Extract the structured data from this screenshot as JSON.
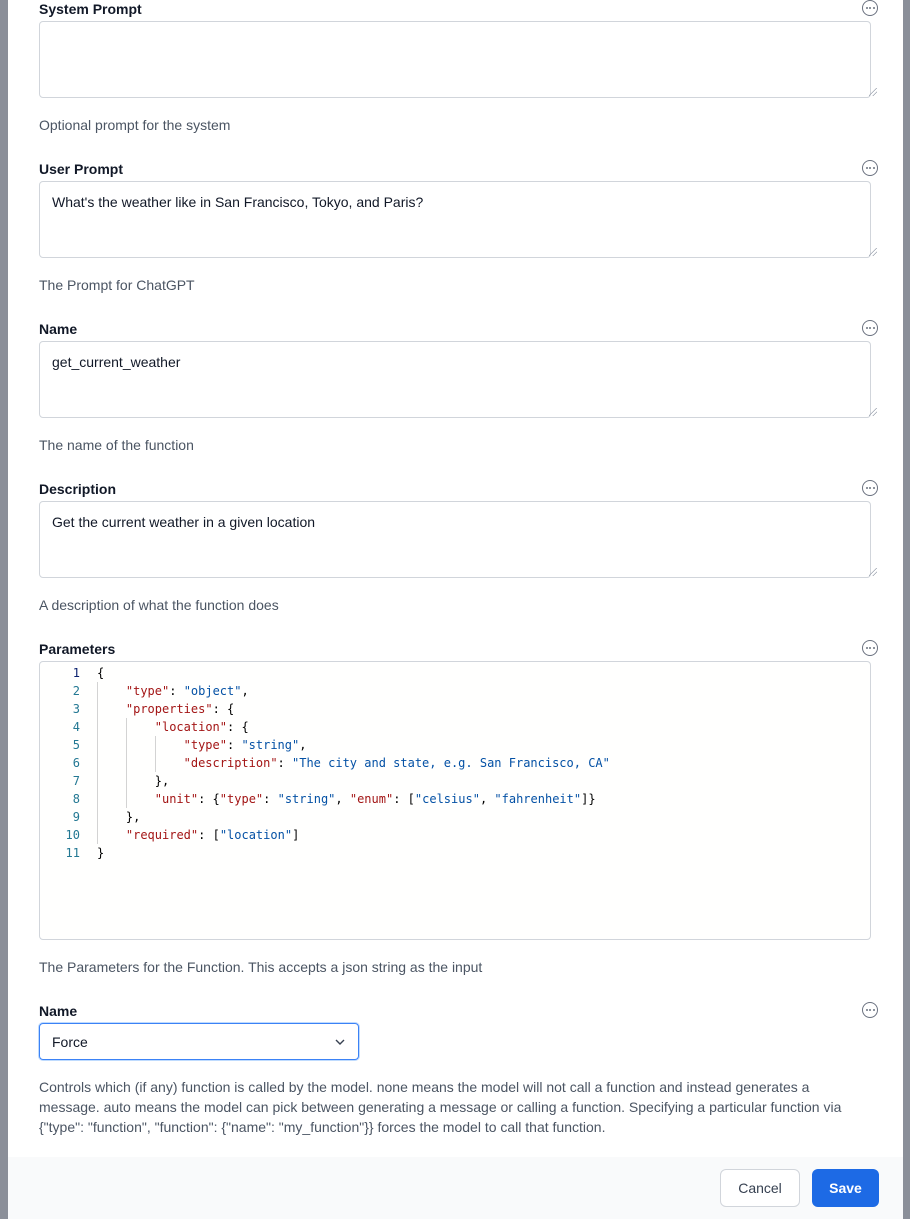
{
  "fields": [
    {
      "label": "System Prompt",
      "value": "",
      "hint": "Optional prompt for the system"
    },
    {
      "label": "User Prompt",
      "value": "What's the weather like in San Francisco, Tokyo, and Paris?",
      "hint": "The Prompt for ChatGPT"
    },
    {
      "label": "Name",
      "value": "get_current_weather",
      "hint": "The name of the function"
    },
    {
      "label": "Description",
      "value": "Get the current weather in a given location",
      "hint": "A description of what the function does"
    }
  ],
  "parameters": {
    "label": "Parameters",
    "hint": "The Parameters for the Function. This accepts a json string as the input",
    "lines": [
      {
        "n": "1",
        "indent": 0,
        "tokens": [
          [
            "p",
            "{"
          ]
        ]
      },
      {
        "n": "2",
        "indent": 1,
        "tokens": [
          [
            "k",
            "\"type\""
          ],
          [
            "p",
            ": "
          ],
          [
            "s",
            "\"object\""
          ],
          [
            "p",
            ","
          ]
        ]
      },
      {
        "n": "3",
        "indent": 1,
        "tokens": [
          [
            "k",
            "\"properties\""
          ],
          [
            "p",
            ": {"
          ]
        ]
      },
      {
        "n": "4",
        "indent": 2,
        "tokens": [
          [
            "k",
            "\"location\""
          ],
          [
            "p",
            ": {"
          ]
        ]
      },
      {
        "n": "5",
        "indent": 3,
        "tokens": [
          [
            "k",
            "\"type\""
          ],
          [
            "p",
            ": "
          ],
          [
            "s",
            "\"string\""
          ],
          [
            "p",
            ","
          ]
        ]
      },
      {
        "n": "6",
        "indent": 3,
        "tokens": [
          [
            "k",
            "\"description\""
          ],
          [
            "p",
            ": "
          ],
          [
            "s",
            "\"The city and state, e.g. San Francisco, CA\""
          ]
        ]
      },
      {
        "n": "7",
        "indent": 2,
        "tokens": [
          [
            "p",
            "},"
          ]
        ]
      },
      {
        "n": "8",
        "indent": 2,
        "tokens": [
          [
            "k",
            "\"unit\""
          ],
          [
            "p",
            ": {"
          ],
          [
            "k",
            "\"type\""
          ],
          [
            "p",
            ": "
          ],
          [
            "s",
            "\"string\""
          ],
          [
            "p",
            ", "
          ],
          [
            "k",
            "\"enum\""
          ],
          [
            "p",
            ": ["
          ],
          [
            "s",
            "\"celsius\""
          ],
          [
            "p",
            ", "
          ],
          [
            "s",
            "\"fahrenheit\""
          ],
          [
            "p",
            "]}"
          ]
        ]
      },
      {
        "n": "9",
        "indent": 1,
        "tokens": [
          [
            "p",
            "},"
          ]
        ]
      },
      {
        "n": "10",
        "indent": 1,
        "tokens": [
          [
            "k",
            "\"required\""
          ],
          [
            "p",
            ": ["
          ],
          [
            "s",
            "\"location\""
          ],
          [
            "p",
            "]"
          ]
        ]
      },
      {
        "n": "11",
        "indent": 0,
        "tokens": [
          [
            "p",
            "}"
          ]
        ]
      }
    ]
  },
  "function_call": {
    "label": "Name",
    "selected": "Force",
    "hint": "Controls which (if any) function is called by the model. none means the model will not call a function and instead generates a message. auto means the model can pick between generating a message or calling a function. Specifying a particular function via {\"type\": \"function\", \"function\": {\"name\": \"my_function\"}} forces the model to call that function."
  },
  "footer": {
    "cancel": "Cancel",
    "save": "Save"
  },
  "icons": {
    "field_menu": "ellipsis-circle-icon",
    "select": "chevron-down-icon"
  },
  "colors": {
    "primary": "#1d6ae5",
    "json_key": "#a31515",
    "json_string": "#0451a5"
  }
}
